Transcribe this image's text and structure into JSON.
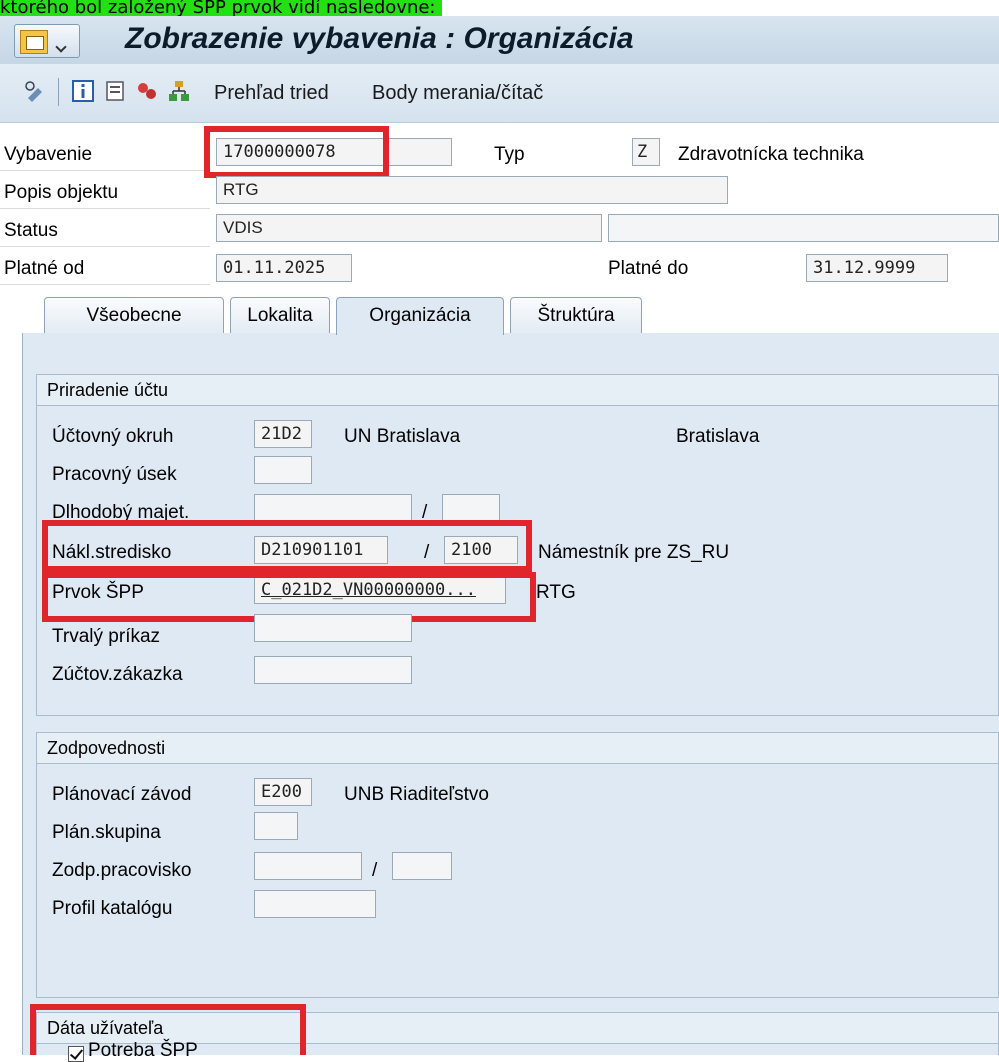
{
  "banner": {
    "text": "ktorého bol založený ŠPP prvok vidí nasledovne:"
  },
  "window": {
    "title": "Zobrazenie vybavenia : Organizácia"
  },
  "toolbar": {
    "icons": [
      "display-change-icon",
      "info-icon",
      "document-icon",
      "classification-icon",
      "hierarchy-icon"
    ],
    "links": [
      "Prehľad tried",
      "Body merania/čítač"
    ]
  },
  "header": {
    "equipment_label": "Vybavenie",
    "equipment_value": "17000000078",
    "type_label": "Typ",
    "type_value": "Z",
    "type_text": "Zdravotnícka technika",
    "description_label": "Popis objektu",
    "description_value": "RTG",
    "status_label": "Status",
    "status_value": "VDIS",
    "valid_from_label": "Platné od",
    "valid_from_value": "01.11.2025",
    "valid_to_label": "Platné do",
    "valid_to_value": "31.12.9999"
  },
  "tabs": [
    {
      "label": "Všeobecne",
      "active": false
    },
    {
      "label": "Lokalita",
      "active": false
    },
    {
      "label": "Organizácia",
      "active": true
    },
    {
      "label": "Štruktúra",
      "active": false
    }
  ],
  "account_assignment": {
    "title": "Priradenie účtu",
    "company_code_label": "Účtovný okruh",
    "company_code_value": "21D2",
    "company_code_text": "UN Bratislava",
    "company_code_city": "Bratislava",
    "business_area_label": "Pracovný úsek",
    "asset_label": "Dlhodobý majet.",
    "asset_sep": "/",
    "cost_center_label": "Nákl.stredisko",
    "cost_center_value": "D210901101",
    "cost_center_sep": "/ ",
    "cost_center_area": "2100",
    "cost_center_text": "Námestník pre ZS_RU",
    "wbs_label": "Prvok ŠPP",
    "wbs_value": "C_021D2_VN00000000...",
    "wbs_text": "RTG",
    "standing_order_label": "Trvalý príkaz",
    "settlement_order_label": "Zúčtov.zákazka"
  },
  "responsibilities": {
    "title": "Zodpovednosti",
    "planning_plant_label": "Plánovací závod",
    "planning_plant_value": "E200",
    "planning_plant_text": "UNB Riaditeľstvo",
    "planner_group_label": "Plán.skupina",
    "work_center_label": "Zodp.pracovisko",
    "work_center_sep": "/",
    "catalog_profile_label": "Profil katalógu"
  },
  "user_data": {
    "title": "Dáta užívateľa",
    "checkbox_label": "Potreba ŠPP",
    "checked": true
  },
  "colors": {
    "highlight_box": "#e0262b",
    "banner": "#22e012",
    "panel": "#dfe9f3"
  }
}
